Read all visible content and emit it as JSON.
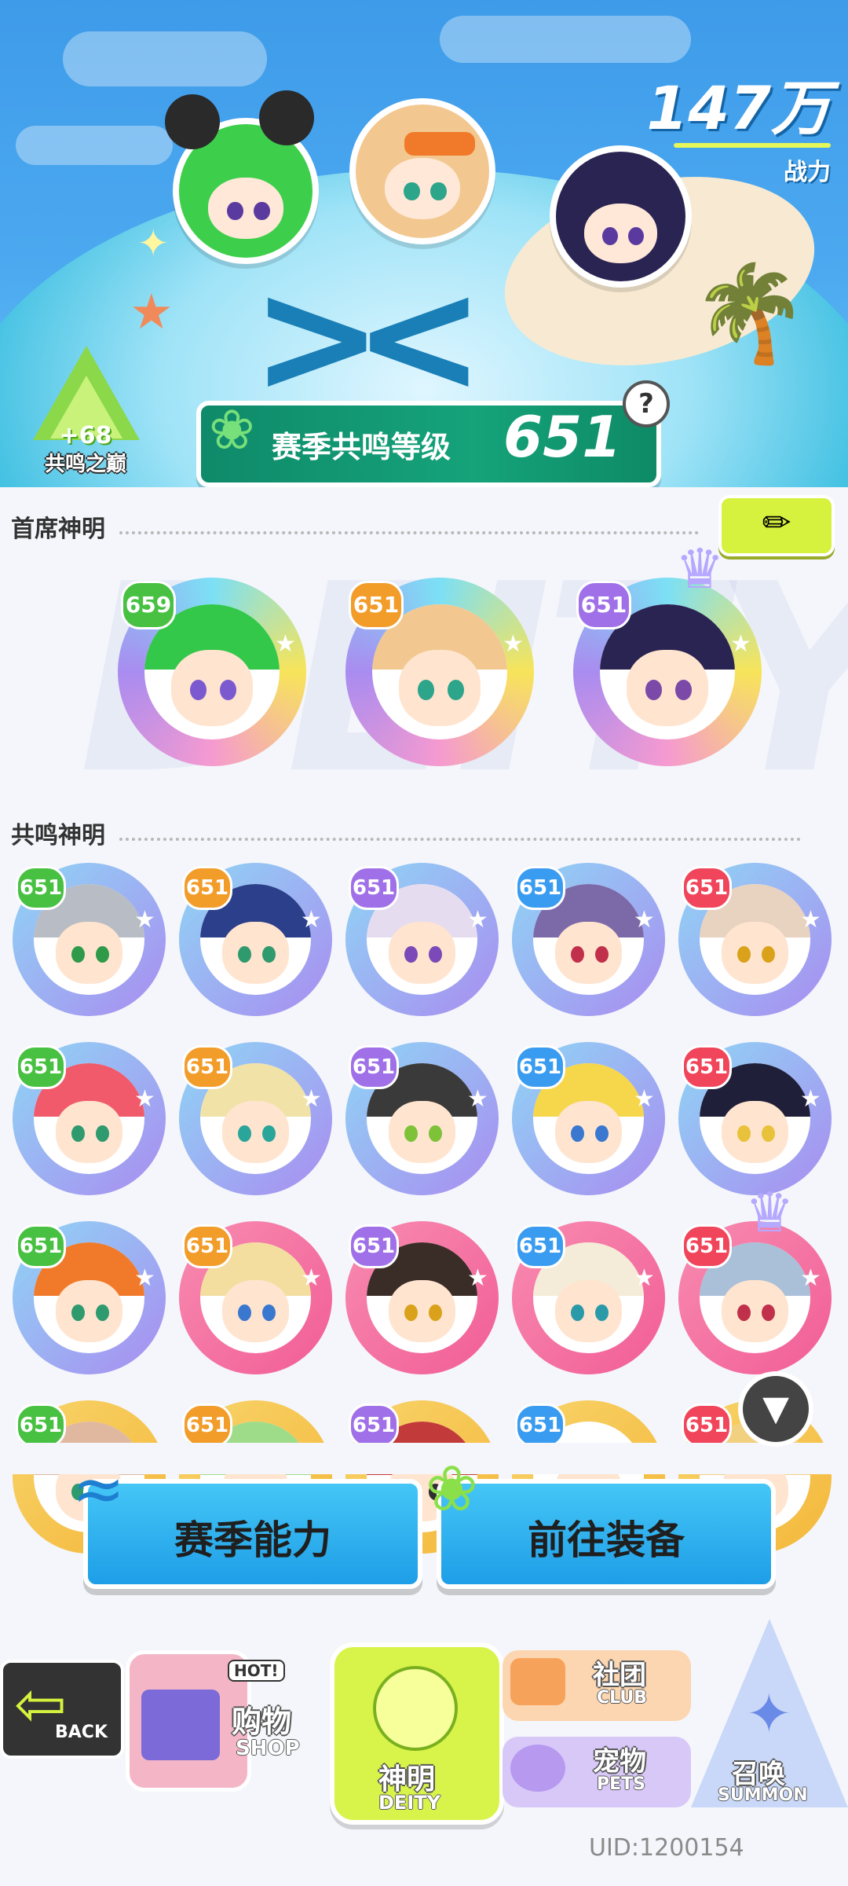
{
  "header": {
    "power_value": "147万",
    "power_label": "战力"
  },
  "peak_badge": {
    "bonus": "+68",
    "name": "共鸣之巅"
  },
  "season": {
    "label": "赛季共鸣等级",
    "level": "651"
  },
  "sections": {
    "lead_title": "首席神明",
    "resonance_title": "共鸣神明"
  },
  "lead_deities": [
    {
      "level": "659",
      "ring": "rainbow",
      "hair": "#33c84a",
      "eye": "#7b5ad0"
    },
    {
      "level": "651",
      "ring": "rainbow",
      "hair": "#f2c890",
      "eye": "#2da58a"
    },
    {
      "level": "651",
      "ring": "rainbow",
      "hair": "#2a2452",
      "eye": "#7b4aa8",
      "crowned": true
    }
  ],
  "resonance_deities": [
    {
      "level": "651",
      "ring": "purple",
      "hair": "#b8bcc4",
      "eye": "#2e9a4a"
    },
    {
      "level": "651",
      "ring": "purple",
      "hair": "#2c3f8a",
      "eye": "#2e9a6e"
    },
    {
      "level": "651",
      "ring": "purple",
      "hair": "#e6dcf0",
      "eye": "#7b4ab8"
    },
    {
      "level": "651",
      "ring": "purple",
      "hair": "#7c6aa8",
      "eye": "#c0304a"
    },
    {
      "level": "651",
      "ring": "purple",
      "hair": "#e8d2c0",
      "eye": "#d9a21a"
    },
    {
      "level": "651",
      "ring": "purple",
      "hair": "#f05a6a",
      "eye": "#2e9a6e"
    },
    {
      "level": "651",
      "ring": "purple",
      "hair": "#f1e2a8",
      "eye": "#2aa59a"
    },
    {
      "level": "651",
      "ring": "purple",
      "hair": "#3a3a3a",
      "eye": "#7ec23a"
    },
    {
      "level": "651",
      "ring": "purple",
      "hair": "#f6d64a",
      "eye": "#3a78d0"
    },
    {
      "level": "651",
      "ring": "purple",
      "hair": "#1f1f3a",
      "eye": "#e8c23a"
    },
    {
      "level": "651",
      "ring": "purple",
      "hair": "#f07a2a",
      "eye": "#2e9a6e"
    },
    {
      "level": "651",
      "ring": "pink",
      "hair": "#f3dea0",
      "eye": "#3a78d0"
    },
    {
      "level": "651",
      "ring": "pink",
      "hair": "#3a2c26",
      "eye": "#d9a21a"
    },
    {
      "level": "651",
      "ring": "pink",
      "hair": "#f4ecd8",
      "eye": "#2a9aa8"
    },
    {
      "level": "651",
      "ring": "pink",
      "hair": "#aac0d8",
      "eye": "#c0304a",
      "crowned": true
    },
    {
      "level": "651",
      "ring": "gold",
      "hair": "#e0b8a0",
      "eye": "#2e9a6e"
    },
    {
      "level": "651",
      "ring": "gold",
      "hair": "#9fdc8a",
      "eye": "#2e9a6e"
    },
    {
      "level": "651",
      "ring": "gold",
      "hair": "#c23a3a",
      "eye": "#2e2e2e"
    },
    {
      "level": "651",
      "ring": "gold",
      "hair": "#ffffff",
      "eye": "#2e78c0"
    },
    {
      "level": "651",
      "ring": "gold",
      "hair": "#f1d080",
      "eye": "#2e9a6e"
    }
  ],
  "actions": {
    "season_ability": "赛季能力",
    "go_equip": "前往装备"
  },
  "nav": {
    "back": "BACK",
    "shop_cn": "购物",
    "shop_en": "SHOP",
    "shop_hot": "HOT!",
    "deity_cn": "神明",
    "deity_en": "DEITY",
    "club_cn": "社团",
    "club_en": "CLUB",
    "pets_cn": "宠物",
    "pets_en": "PETS",
    "summon_cn": "召唤",
    "summon_en": "SUMMON"
  },
  "uid": "UID:1200154",
  "colors": {
    "ring_rainbow": "#7ce0f5",
    "ring_purple": "#a98cf0",
    "ring_pink": "#f25d96",
    "ring_gold": "#f4b73a",
    "badge_green": "#48c142",
    "badge_orange": "#f29c2a",
    "badge_purple": "#a070e8",
    "badge_blue": "#3a9cf0",
    "badge_red": "#f0455a",
    "accent_lime": "#d6f23e"
  }
}
